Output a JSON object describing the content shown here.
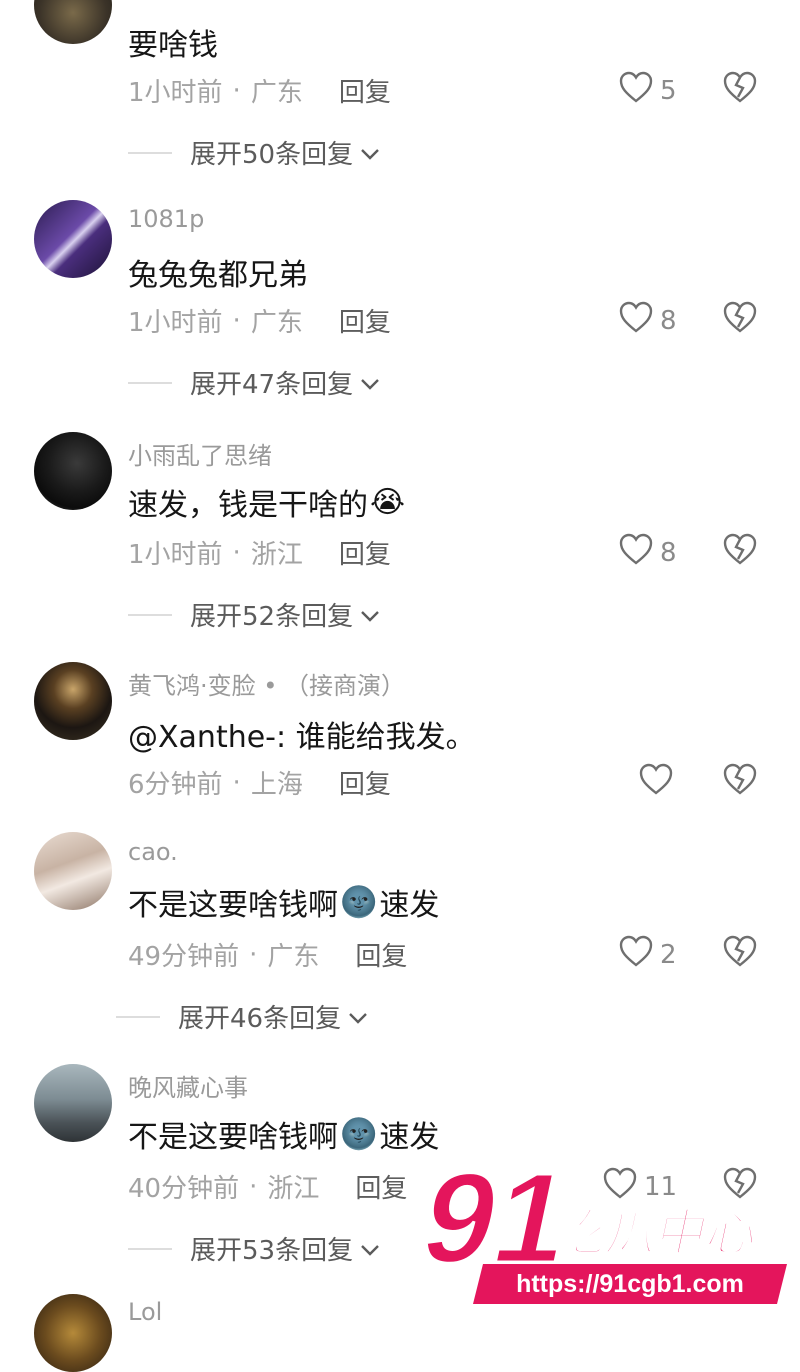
{
  "colors": {
    "accent": "#e4155c",
    "muted": "#a3a3a3"
  },
  "icons": {
    "like": "heart-outline-icon",
    "dislike": "broken-heart-icon",
    "expand": "chevron-down-icon"
  },
  "comments": [
    {
      "username": "",
      "text": "要啥钱",
      "time": "1小时前",
      "location": "广东",
      "reply_label": "回复",
      "likes": "5",
      "expand_label": "展开50条回复"
    },
    {
      "username": "1081p",
      "text": "兔兔兔都兄弟",
      "time": "1小时前",
      "location": "广东",
      "reply_label": "回复",
      "likes": "8",
      "expand_label": "展开47条回复"
    },
    {
      "username": "小雨乱了思绪",
      "text": "速发，钱是干啥的",
      "emoji": "😭",
      "time": "1小时前",
      "location": "浙江",
      "reply_label": "回复",
      "likes": "8",
      "expand_label": "展开52条回复"
    },
    {
      "username": "黄飞鸿·变脸 • （接商演）",
      "text": "@Xanthe-: 谁能给我发。",
      "time": "6分钟前",
      "location": "上海",
      "reply_label": "回复",
      "likes": ""
    },
    {
      "username": "cao.",
      "text_before": "不是这要啥钱啊",
      "emoji": "🌚",
      "text_after": "速发",
      "time": "49分钟前",
      "location": "广东",
      "reply_label": "回复",
      "likes": "2",
      "expand_label": "展开46条回复"
    },
    {
      "username": "晚风藏心事",
      "text_before": "不是这要啥钱啊",
      "emoji": "🌚",
      "text_after": "速发",
      "time": "40分钟前",
      "location": "浙江",
      "reply_label": "回复",
      "likes": "11",
      "expand_label": "展开53条回复"
    },
    {
      "username": "Lol"
    }
  ],
  "watermark": {
    "logo_number": "91",
    "logo_text": "吃瓜中心",
    "url": "https://91cgb1.com"
  }
}
